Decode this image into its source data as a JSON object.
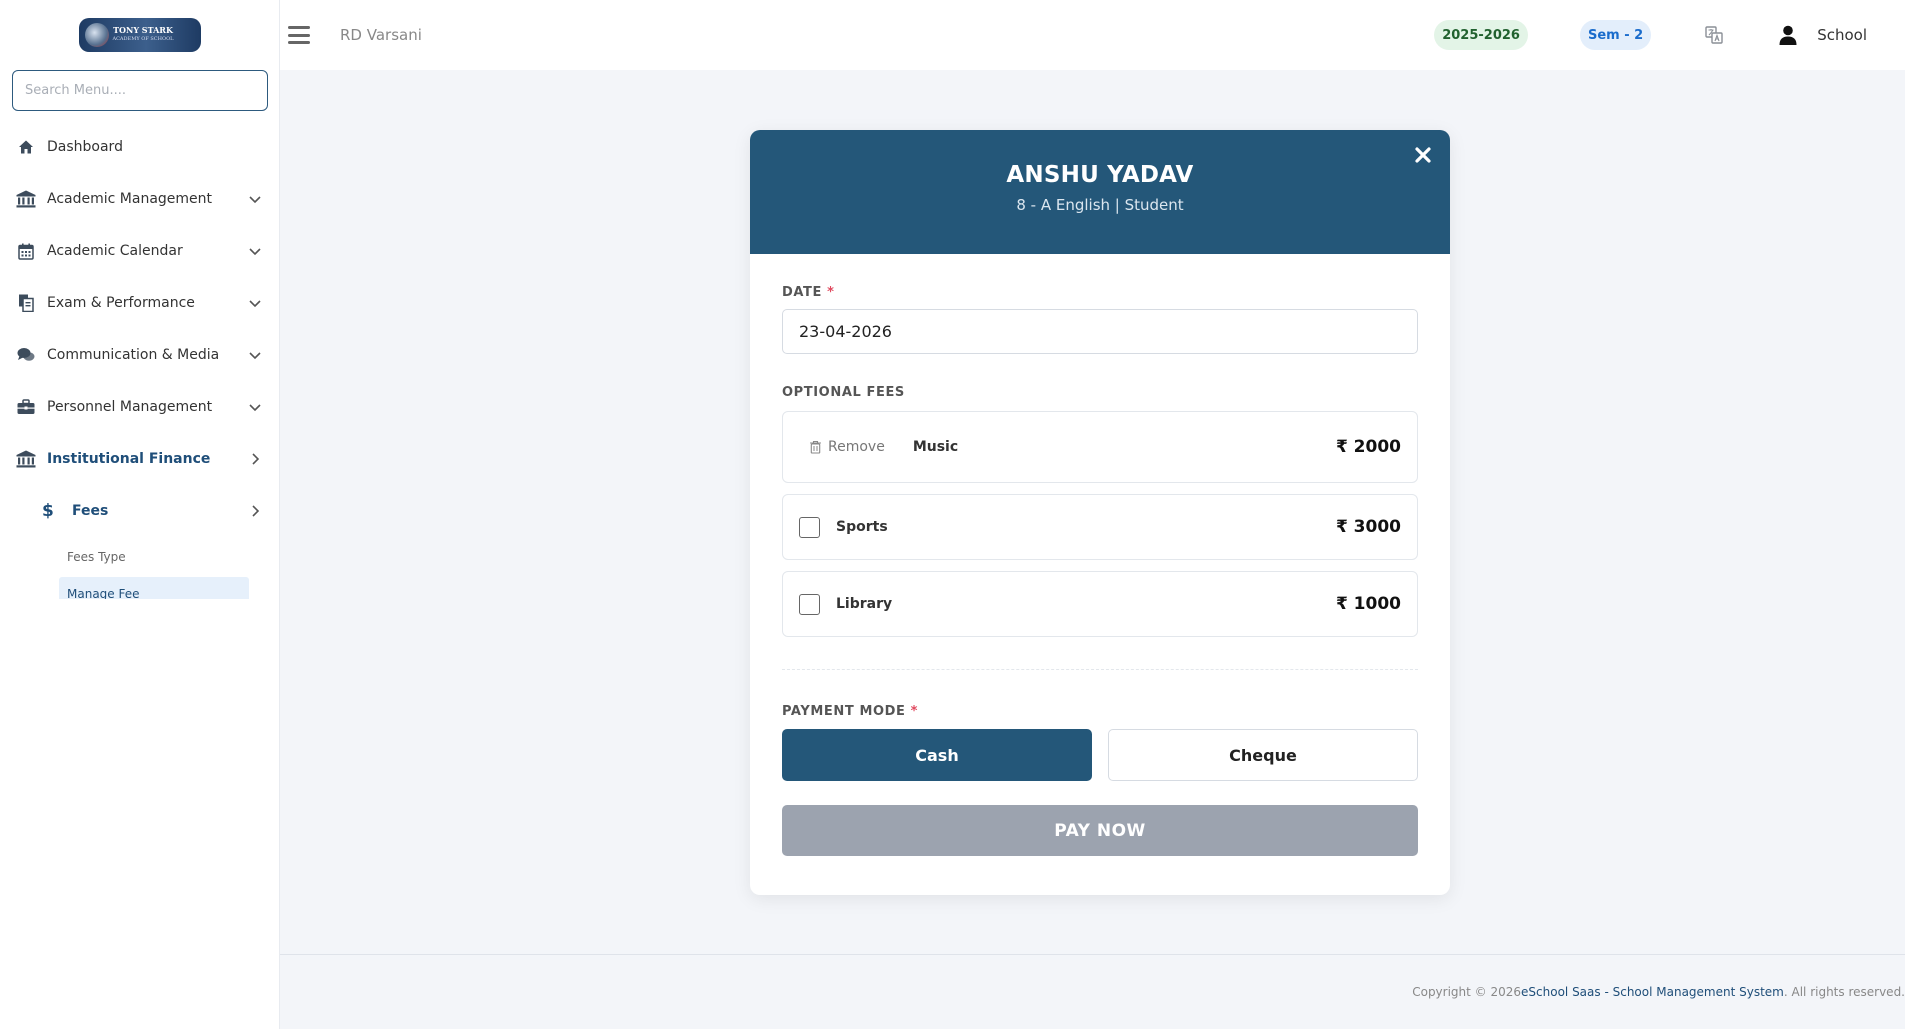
{
  "sidebar": {
    "logo": {
      "line1": "TONY STARK",
      "line2": "ACADEMY OF SCHOOL"
    },
    "search_placeholder": "Search Menu....",
    "items": [
      {
        "label": "Dashboard",
        "icon": "home-icon"
      },
      {
        "label": "Academic Management",
        "icon": "institution-icon"
      },
      {
        "label": "Academic Calendar",
        "icon": "calendar-icon"
      },
      {
        "label": "Exam & Performance",
        "icon": "documents-icon"
      },
      {
        "label": "Communication & Media",
        "icon": "chat-icon"
      },
      {
        "label": "Personnel Management",
        "icon": "briefcase-icon"
      },
      {
        "label": "Institutional Finance",
        "icon": "institution-icon"
      }
    ],
    "fees": {
      "label": "Fees",
      "icon_glyph": "$",
      "children": [
        "Fees Type",
        "Manage Fee"
      ]
    }
  },
  "topbar": {
    "school": "RD Varsani",
    "session": "2025-2026",
    "semester": "Sem - 2",
    "user": "School"
  },
  "modal": {
    "student_name": "ANSHU YADAV",
    "student_sub": "8 - A English | Student",
    "date_label": "DATE",
    "required_mark": "*",
    "date_value": "23-04-2026",
    "optional_label": "OPTIONAL FEES",
    "fees": [
      {
        "name": "Music",
        "amount": "₹ 2000",
        "remove_label": "Remove",
        "selected": true
      },
      {
        "name": "Sports",
        "amount": "₹ 3000",
        "selected": false
      },
      {
        "name": "Library",
        "amount": "₹ 1000",
        "selected": false
      }
    ],
    "payment_label": "PAYMENT MODE",
    "modes": [
      "Cash",
      "Cheque"
    ],
    "active_mode": "Cash",
    "pay_now": "PAY NOW"
  },
  "footer": {
    "prefix": "Copyright © 2026 ",
    "brand": "eSchool Saas - School Management System",
    "suffix": ". All rights reserved."
  },
  "colors": {
    "primary": "#245779",
    "sidebar_active": "#1f4e79",
    "pay_disabled": "#9ca3af",
    "required": "#e04a5f"
  }
}
